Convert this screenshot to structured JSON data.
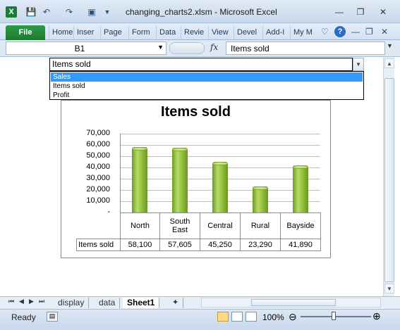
{
  "window": {
    "title": "changing_charts2.xlsm  -  Microsoft Excel",
    "app_icon": "X",
    "controls": [
      "minimize-icon",
      "restore-icon",
      "close-icon"
    ]
  },
  "ribbon": {
    "file_label": "File",
    "tabs": [
      "Home",
      "Insert",
      "Page",
      "Formulas",
      "Data",
      "Review",
      "View",
      "Developer",
      "Add-Ins",
      "My M"
    ],
    "tab_display": [
      "Home",
      "Inser",
      "Page",
      "Form",
      "Data",
      "Revie",
      "View",
      "Devel",
      "Add-I",
      "My M"
    ]
  },
  "formula_bar": {
    "name_box": "B1",
    "fx_label": "fx",
    "formula": "Items sold"
  },
  "dropdown": {
    "selected": "Items sold",
    "options": [
      "Sales",
      "Items sold",
      "Profit"
    ],
    "highlighted_index": 0
  },
  "chart_data": {
    "type": "bar",
    "title": "Items sold",
    "categories": [
      "North",
      "South East",
      "Central",
      "Rural",
      "Bayside"
    ],
    "category_display": [
      "North",
      "South\nEast",
      "Central",
      "Rural",
      "Bayside"
    ],
    "series": [
      {
        "name": "Items sold",
        "values": [
          58100,
          57605,
          45250,
          23290,
          41890
        ]
      }
    ],
    "value_labels": [
      "58,100",
      "57,605",
      "45,250",
      "23,290",
      "41,890"
    ],
    "y_ticks": [
      "70,000",
      "60,000",
      "50,000",
      "40,000",
      "30,000",
      "20,000",
      "10,000",
      "-"
    ],
    "ylim": [
      0,
      70000
    ],
    "grid": true,
    "data_table": true
  },
  "sheet_tabs": {
    "tabs": [
      "display",
      "data",
      "Sheet1"
    ],
    "active": "Sheet1"
  },
  "status": {
    "ready": "Ready",
    "zoom": "100%",
    "zoom_level_percent": 100
  }
}
